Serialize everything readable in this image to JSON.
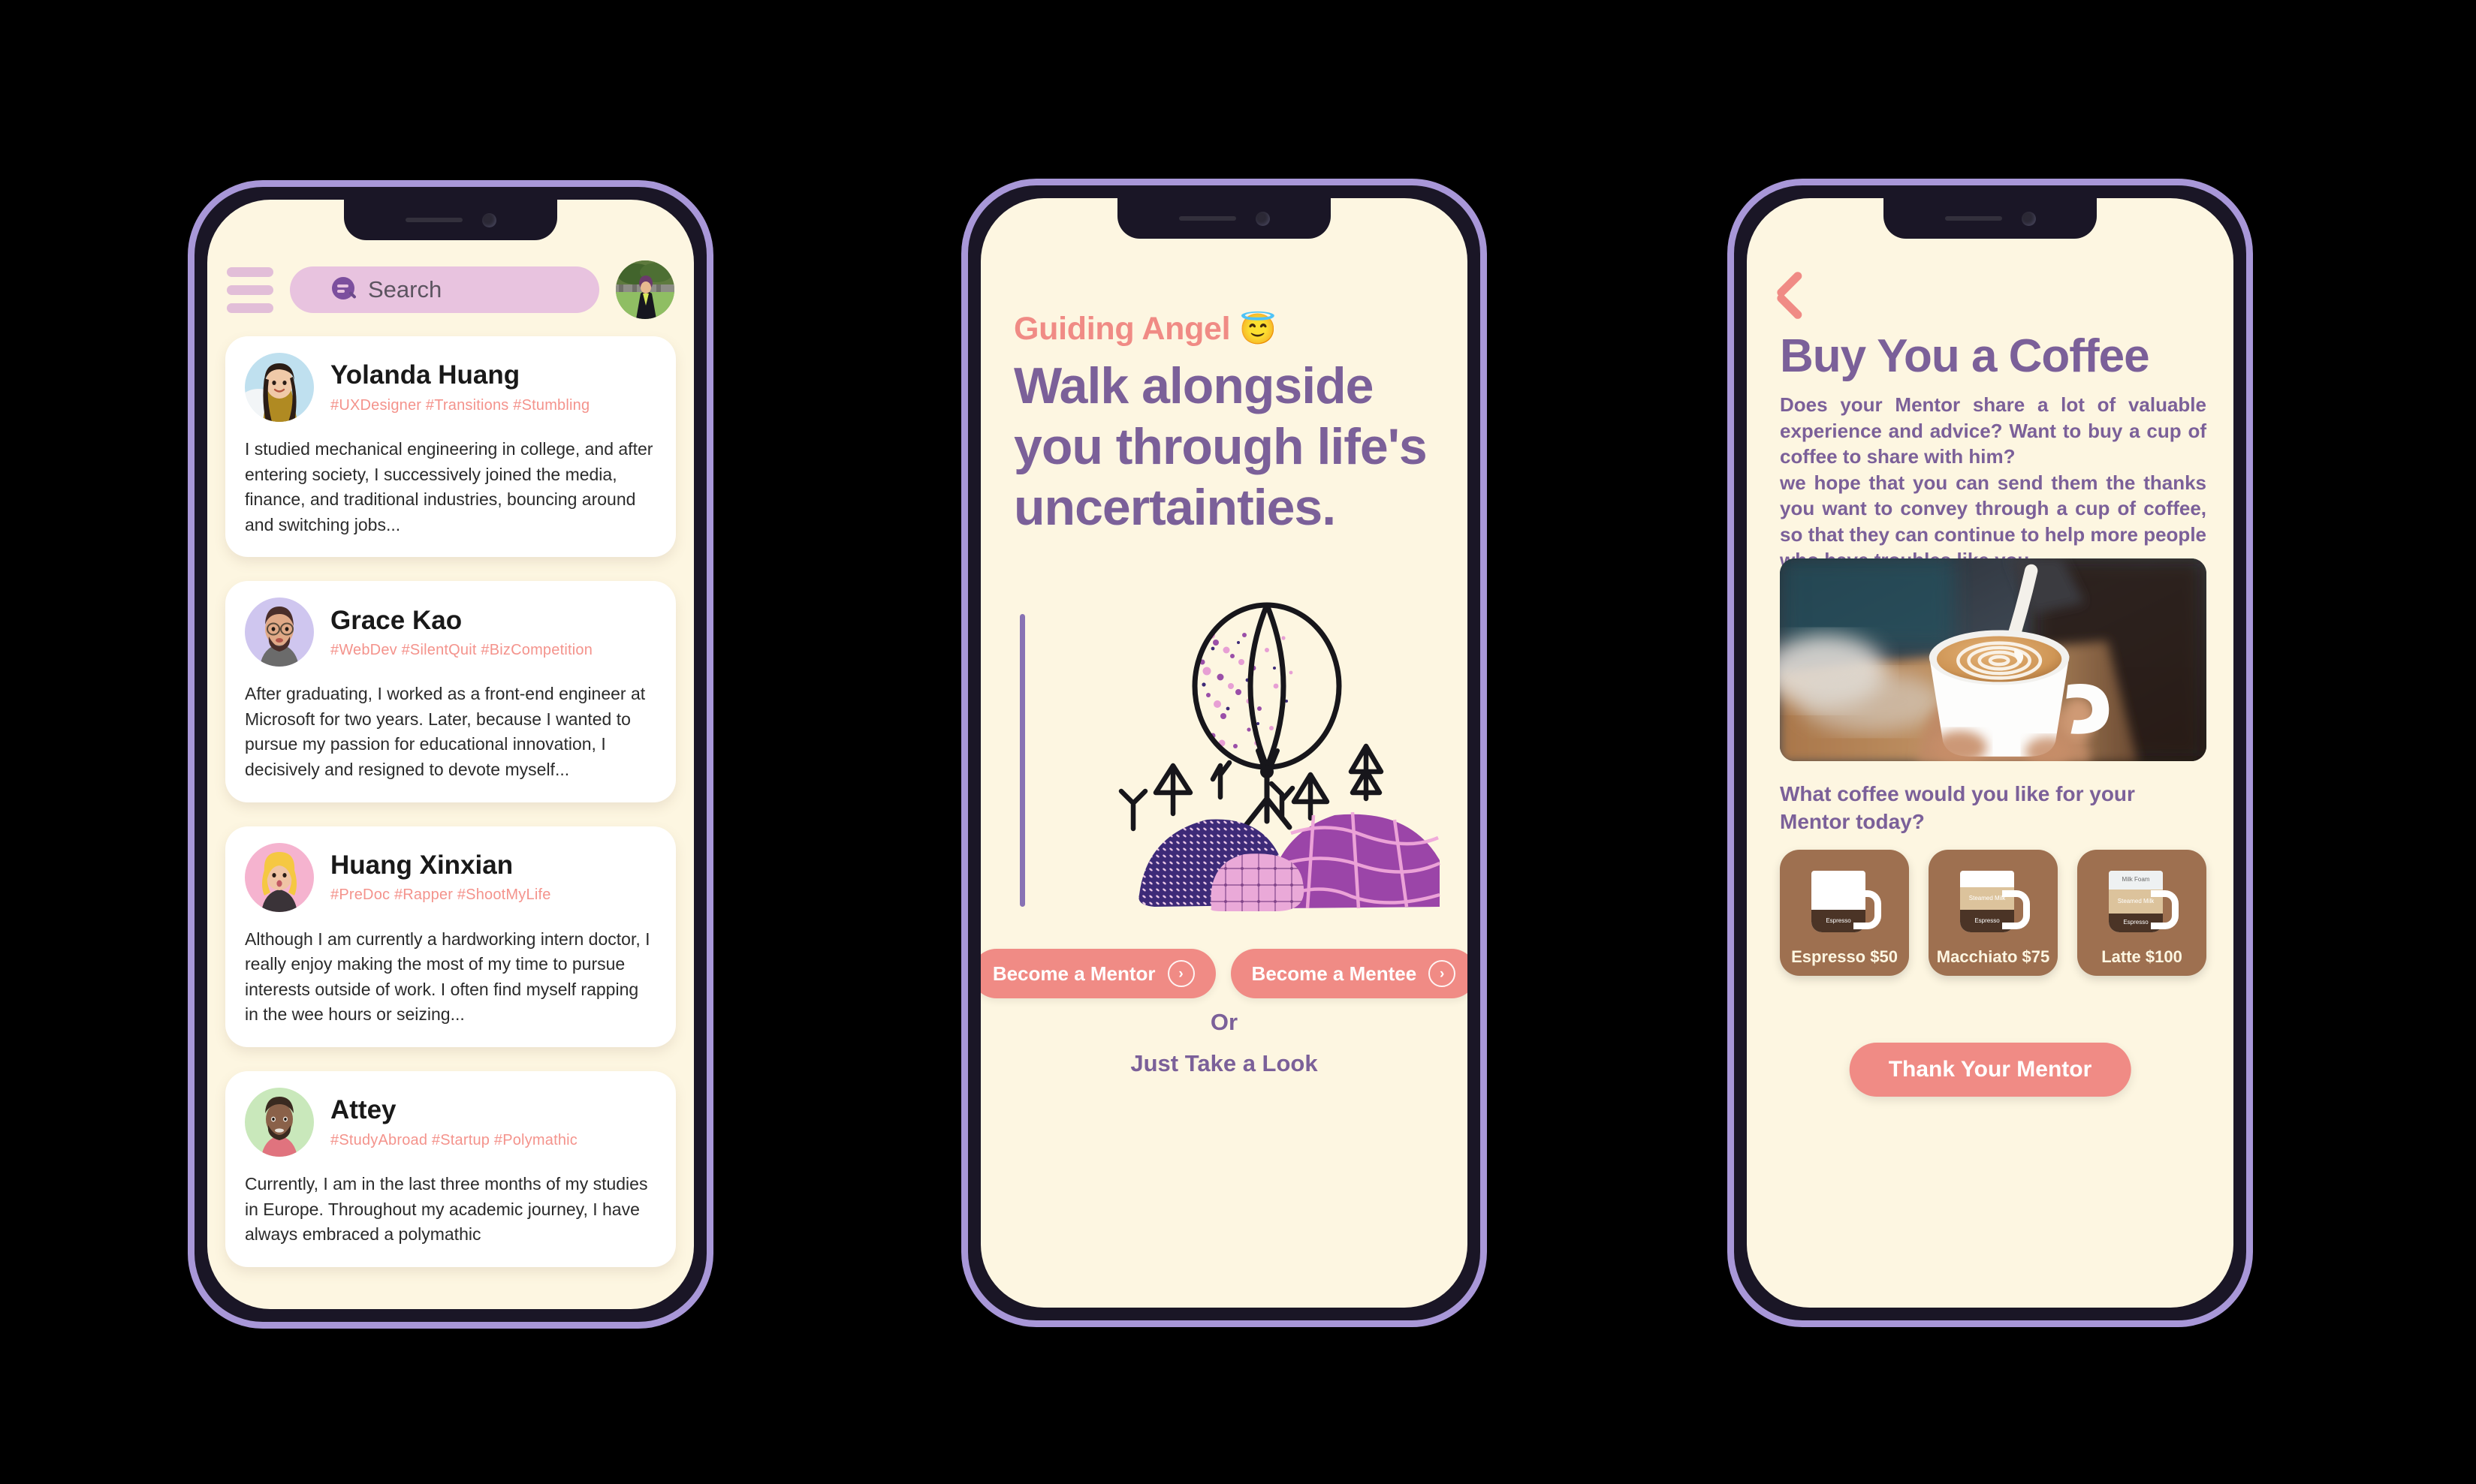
{
  "phone1": {
    "header": {
      "menu_icon": "hamburger-icon",
      "search_icon": "search-icon",
      "search_placeholder": "Search",
      "avatar_alt": "user-avatar"
    },
    "cards": [
      {
        "name": "Yolanda Huang",
        "tags": "#UXDesigner #Transitions #Stumbling",
        "bio": "I studied mechanical engineering in college, and after entering society, I successively joined the media, finance, and traditional industries, bouncing around and switching jobs...",
        "avatar_bg": "#bfe0ef",
        "avatar_skin": "#f0c9a8",
        "avatar_hair": "#2b1d16",
        "avatar_shirt": "#b08a22"
      },
      {
        "name": "Grace Kao",
        "tags": "#WebDev #SilentQuit #BizCompetition",
        "bio": "After graduating, I worked as a front-end engineer at Microsoft for two years. Later, because I wanted to pursue my passion for educational innovation, I decisively and resigned to devote myself...",
        "avatar_bg": "#cfc6ef",
        "avatar_skin": "#e0a987",
        "avatar_hair": "#4a2e2a",
        "avatar_shirt": "#6b6b6b"
      },
      {
        "name": "Huang Xinxian",
        "tags": "#PreDoc #Rapper #ShootMyLife",
        "bio": "Although I am currently a hardworking intern doctor, I really enjoy making the most of my time to pursue interests outside of work. I often find myself rapping in the wee hours or seizing...",
        "avatar_bg": "#f5b3cf",
        "avatar_skin": "#f0c4a5",
        "avatar_hair": "#f5c842",
        "avatar_shirt": "#3a3338"
      },
      {
        "name": "Attey",
        "tags": "#StudyAbroad #Startup #Polymathic",
        "bio": "Currently, I am in the last three months of my studies in Europe. Throughout my academic journey, I have always embraced a polymathic",
        "avatar_bg": "#c9e8bb",
        "avatar_skin": "#8a6149",
        "avatar_hair": "#3a2a20",
        "avatar_shirt": "#e0737e"
      }
    ]
  },
  "phone2": {
    "kicker": "Guiding Angel",
    "kicker_emoji": "😇",
    "headline": "Walk alongside you through life's uncertainties.",
    "illustration": "balloon-trees-hills-illustration",
    "cta_mentor": "Become a Mentor",
    "cta_mentee": "Become a Mentee",
    "cta_arrow_icon": "chevron-right-circle-icon",
    "or_label": "Or",
    "just_look": "Just Take a Look"
  },
  "phone3": {
    "back_icon": "back-chevron-icon",
    "title": "Buy You a Coffee",
    "paragraph_1": "Does your Mentor share a lot of valuable experience and advice? Want to buy a cup of coffee to share with him?",
    "paragraph_2": "we hope that you can send them the thanks you want to convey through a cup of coffee, so that they can continue to help more people who have troubles like you.",
    "photo_alt": "latte-pour-photo",
    "question": "What coffee would you like for your Mentor today?",
    "coffees": [
      {
        "label": "Espresso $50",
        "layers": [
          {
            "name": "Espresso",
            "kind": "espresso",
            "height": 30
          }
        ]
      },
      {
        "label": "Macchiato $75",
        "layers": [
          {
            "name": "Steamed Milk",
            "kind": "steamed",
            "height": 30
          },
          {
            "name": "Espresso",
            "kind": "espresso",
            "height": 30
          }
        ]
      },
      {
        "label": "Latte $100",
        "layers": [
          {
            "name": "Milk Foam",
            "kind": "foam",
            "height": 26
          },
          {
            "name": "Steamed Milk",
            "kind": "steamed",
            "height": 32
          },
          {
            "name": "Espresso",
            "kind": "espresso",
            "height": 26
          }
        ]
      }
    ],
    "thank_button": "Thank Your Mentor"
  },
  "colors": {
    "screen_bg": "#fdf6e1",
    "purple": "#7b6099",
    "coral": "#f08b85",
    "pink_tag": "#f4938c",
    "search_bg": "#e8c3df",
    "brown": "#9e7050",
    "phone_border": "#a897d8"
  }
}
